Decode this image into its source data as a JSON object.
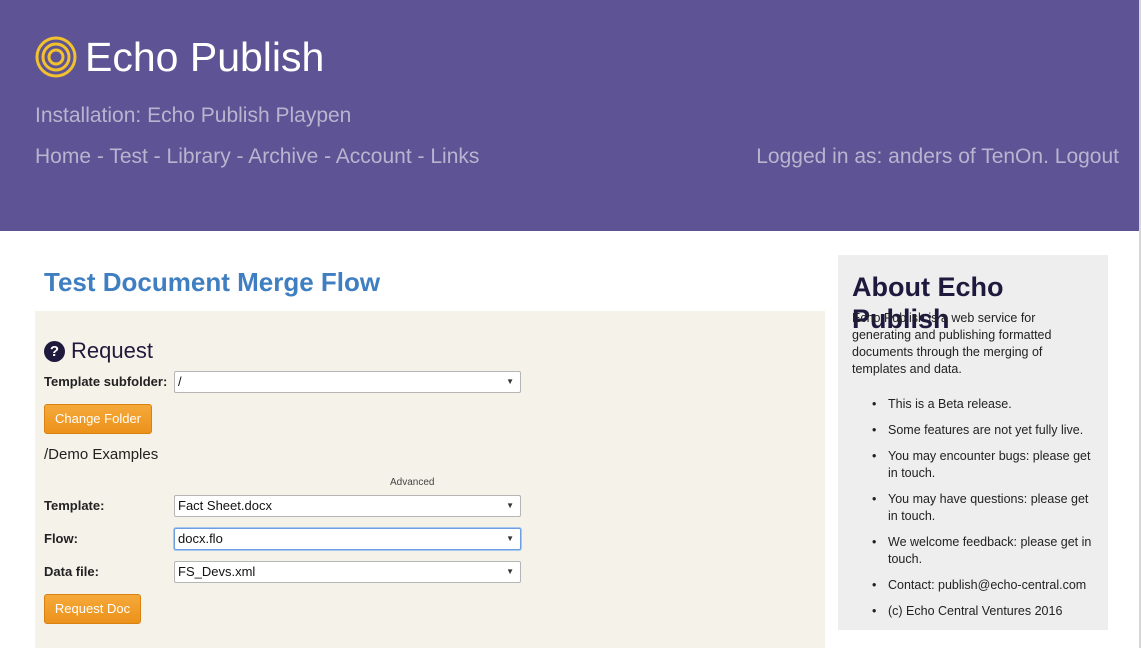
{
  "header": {
    "app_title": "Echo Publish",
    "installation": "Installation: Echo Publish Playpen",
    "nav": [
      "Home",
      "Test",
      "Library",
      "Archive",
      "Account",
      "Links"
    ],
    "nav_separator": " - ",
    "login_text": "Logged in as: anders of TenOn.",
    "logout_label": "Logout"
  },
  "main": {
    "page_title": "Test Document Merge Flow",
    "request": {
      "title": "Request",
      "help_icon": "question-circle-icon",
      "template_subfolder_label": "Template subfolder:",
      "template_subfolder_value": "/",
      "change_folder_label": "Change Folder",
      "folder_path": "/Demo Examples",
      "advanced_label": "Advanced",
      "template_label": "Template:",
      "template_value": "Fact Sheet.docx",
      "flow_label": "Flow:",
      "flow_value": "docx.flo",
      "data_file_label": "Data file:",
      "data_file_value": "FS_Devs.xml",
      "request_doc_label": "Request Doc"
    }
  },
  "sidebar": {
    "title": "About Echo Publish",
    "description": "Echo Publish is a web service for generating and publishing formatted documents through the merging of templates and data.",
    "items": [
      "This is a Beta release.",
      "Some features are not yet fully live.",
      "You may encounter bugs: please get in touch.",
      "You may have questions: please get in touch.",
      "We welcome feedback: please get in touch.",
      "Contact: publish@echo-central.com",
      "(c) Echo Central Ventures 2016"
    ]
  },
  "colors": {
    "header_bg": "#5e5394",
    "link_muted": "#b9b4cf",
    "title_blue": "#3f7ec0",
    "button_orange": "#f0a030",
    "panel_bg": "#f5f2ea",
    "aside_bg": "#eeeeee"
  }
}
